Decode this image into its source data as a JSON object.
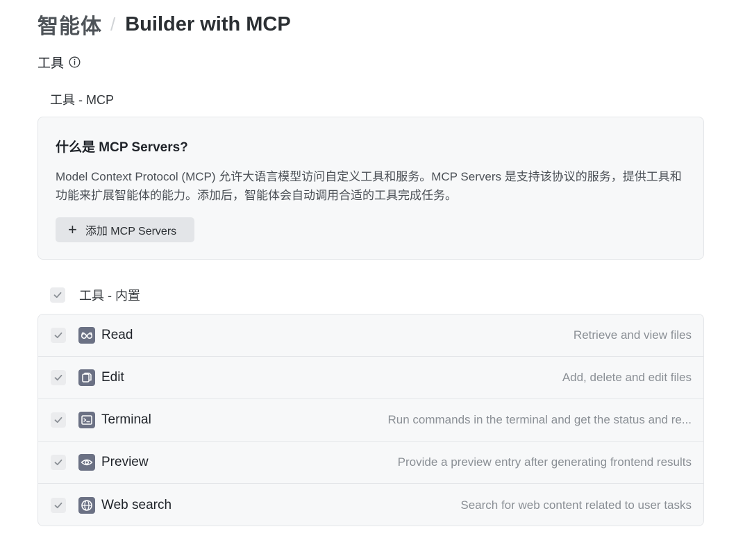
{
  "breadcrumb": {
    "parent": "智能体",
    "separator": "/",
    "current": "Builder with MCP"
  },
  "tools_section": {
    "heading": "工具",
    "info_icon": "info-circle-icon"
  },
  "mcp": {
    "section_label": "工具 - MCP",
    "card_title": "什么是 MCP Servers?",
    "card_description": "Model Context Protocol (MCP) 允许大语言模型访问自定义工具和服务。MCP Servers 是支持该协议的服务，提供工具和功能来扩展智能体的能力。添加后，智能体会自动调用合适的工具完成任务。",
    "add_button_label": "添加 MCP Servers"
  },
  "builtin": {
    "label": "工具 - 内置",
    "checked": true,
    "tools": [
      {
        "name": "Read",
        "description": "Retrieve and view files",
        "icon": "glasses-icon",
        "checked": true
      },
      {
        "name": "Edit",
        "description": "Add, delete and edit files",
        "icon": "copy-file-icon",
        "checked": true
      },
      {
        "name": "Terminal",
        "description": "Run commands in the terminal and get the status and re...",
        "icon": "terminal-icon",
        "checked": true
      },
      {
        "name": "Preview",
        "description": "Provide a preview entry after generating frontend results",
        "icon": "eye-icon",
        "checked": true
      },
      {
        "name": "Web search",
        "description": "Search for web content related to user tasks",
        "icon": "globe-icon",
        "checked": true
      }
    ]
  },
  "colors": {
    "icon_bg": "#6b7184",
    "card_bg": "#f7f8f9",
    "checkbox_bg": "#ebecee",
    "muted_text": "#8a8f95"
  }
}
